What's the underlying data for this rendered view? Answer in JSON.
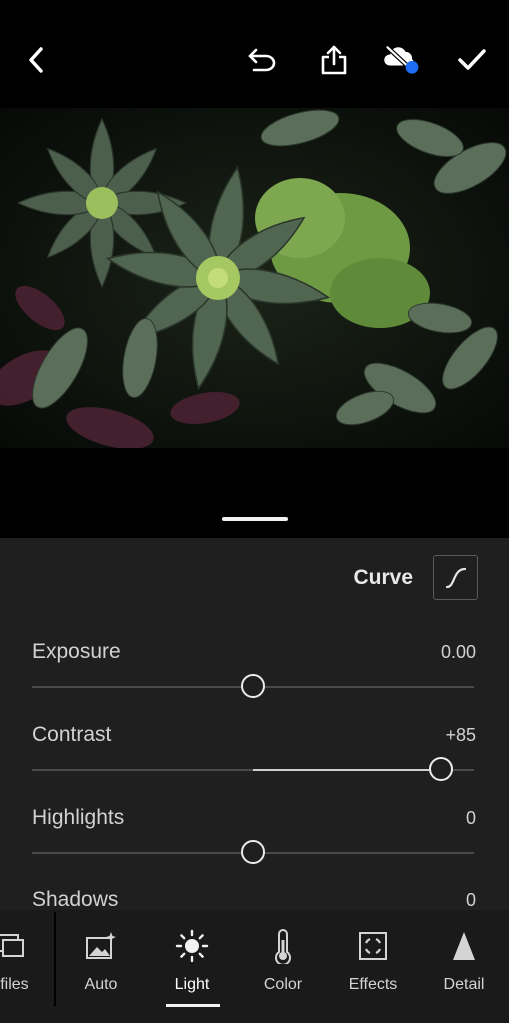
{
  "topbar": {
    "icons": [
      "back-icon",
      "undo-icon",
      "share-icon",
      "cloud-sync-off-icon",
      "checkmark-icon"
    ],
    "accent_dot_color": "#1d6ef5"
  },
  "panel": {
    "curve_label": "Curve",
    "sliders": [
      {
        "name": "Exposure",
        "value": "0.00",
        "level": 0.5
      },
      {
        "name": "Contrast",
        "value": "+85",
        "level": 0.925
      },
      {
        "name": "Highlights",
        "value": "0",
        "level": 0.5
      },
      {
        "name": "Shadows",
        "value": "0",
        "level": 0.5
      }
    ]
  },
  "tabs": [
    {
      "label": "ofiles",
      "icon": "profiles-icon"
    },
    {
      "label": "Auto",
      "icon": "auto-icon"
    },
    {
      "label": "Light",
      "icon": "sun-icon",
      "active": true
    },
    {
      "label": "Color",
      "icon": "thermometer-icon"
    },
    {
      "label": "Effects",
      "icon": "effects-icon"
    },
    {
      "label": "Detail",
      "icon": "detail-icon"
    }
  ]
}
